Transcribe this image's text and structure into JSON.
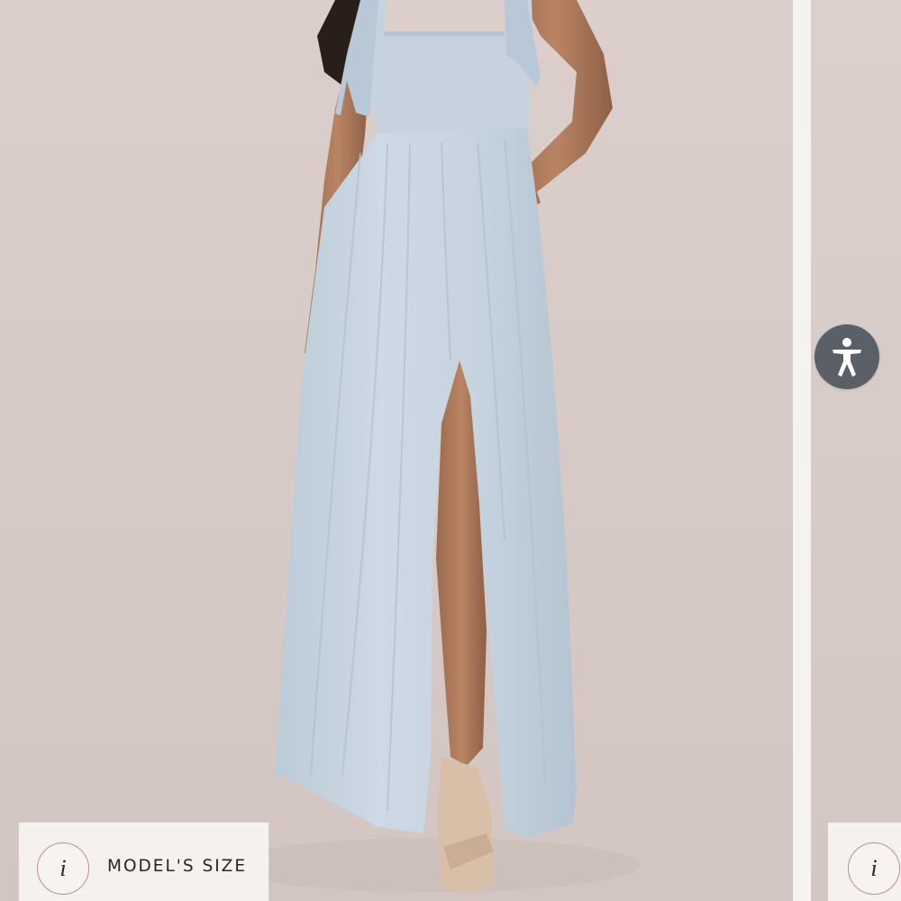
{
  "gallery": {
    "main_image": {
      "alt": "",
      "size_chip": {
        "icon": "info-icon",
        "icon_glyph": "i",
        "label": "MODEL'S SIZE"
      }
    },
    "next_image": {
      "size_chip": {
        "icon": "info-icon",
        "icon_glyph": "i"
      }
    }
  },
  "accessibility": {
    "icon": "accessibility-person-icon",
    "color": "#5a5f68"
  },
  "colors": {
    "backdrop": "#d8cbc7",
    "dress": "#c9d6e2",
    "chip_border": "#d9cbc6",
    "info_ring": "#b7928a"
  }
}
